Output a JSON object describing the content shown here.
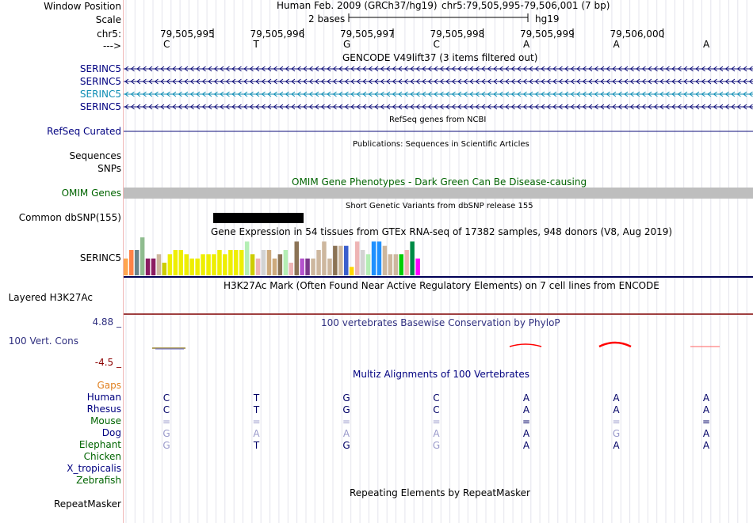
{
  "header": {
    "assembly": "Human Feb. 2009 (GRCh37/hg19)",
    "position": "chr5:79,505,995-79,506,001 (7 bp)",
    "scale_text": "2 bases",
    "scale_db": "hg19"
  },
  "ruler": {
    "chrom_label": "chr5:",
    "arrow_label": "--->",
    "ticks": [
      "79,505,995",
      "79,505,996",
      "79,505,997",
      "79,505,998",
      "79,505,999",
      "79,506,000"
    ],
    "bases": [
      "C",
      "T",
      "G",
      "C",
      "A",
      "A",
      "A"
    ]
  },
  "labels": {
    "window_position": "Window Position",
    "scale": "Scale",
    "gencode": [
      "SERINC5",
      "SERINC5",
      "SERINC5",
      "SERINC5"
    ],
    "refseq": "RefSeq Curated",
    "sequences": "Sequences",
    "snps": "SNPs",
    "omim": "OMIM Genes",
    "dbsnp": "Common dbSNP(155)",
    "gtex": "SERINC5",
    "h3k27ac": "Layered H3K27Ac",
    "cons": "100 Vert. Cons",
    "cons_max": "4.88 _",
    "cons_min": "-4.5 _",
    "repeatmasker": "RepeatMasker"
  },
  "tracks": {
    "gencode_title": "GENCODE V49lift37 (3 items filtered out)",
    "refseq_title": "RefSeq genes from NCBI",
    "pubs_title": "Publications: Sequences in Scientific Articles",
    "omim_title": "OMIM Gene Phenotypes - Dark Green Can Be Disease-causing",
    "dbsnp_title": "Short Genetic Variants from dbSNP release 155",
    "gtex_title": "Gene Expression in 54 tissues from GTEx RNA-seq of 17382 samples, 948 donors (V8, Aug 2019)",
    "h3k27ac_title": "H3K27Ac Mark (Often Found Near Active Regulatory Elements) on 7 cell lines from ENCODE",
    "phylop_title": "100 vertebrates Basewise Conservation by PhyloP",
    "multiz_title": "Multiz Alignments of 100 Vertebrates",
    "repeat_title": "Repeating Elements by RepeatMasker"
  },
  "gtex_colors": [
    "#ffa54f",
    "#ff8247",
    "#68838b",
    "#8fbc8f",
    "#8b1c62",
    "#8b1c62",
    "#cdb79e",
    "#cdcd00",
    "#eeee00",
    "#eeee00",
    "#eeee00",
    "#eeee00",
    "#eeee00",
    "#eeee00",
    "#eeee00",
    "#eeee00",
    "#eeee00",
    "#eeee00",
    "#eeee00",
    "#eeee00",
    "#eeee00",
    "#eeee00",
    "#b4eeb4",
    "#cdcd00",
    "#eeb4b4",
    "#d3d3d3",
    "#cdaa7d",
    "#cdaa7d",
    "#8b7355",
    "#b4eeb4",
    "#eeb4b4",
    "#8b7355",
    "#b452cd",
    "#7a378b",
    "#cdb79e",
    "#cdb79e",
    "#cdb79e",
    "#cdb79e",
    "#8b7355",
    "#cdb79e",
    "#3a5fcd",
    "#ffd700",
    "#eeb4b4",
    "#d3d3d3",
    "#b4eeb4",
    "#1e90ff",
    "#1e90ff",
    "#cdb79e",
    "#cdb79e",
    "#cdb79e",
    "#00cd00",
    "#eeb4b4",
    "#008b45",
    "#ff00ff"
  ],
  "gtex_values": [
    4,
    6,
    6,
    9,
    4,
    4,
    5,
    3,
    5,
    6,
    6,
    5,
    4,
    4,
    5,
    5,
    5,
    6,
    5,
    6,
    6,
    6,
    8,
    5,
    4,
    6,
    6,
    4,
    5,
    6,
    3,
    8,
    4,
    4,
    4,
    6,
    8,
    4,
    7,
    7,
    7,
    2,
    8,
    6,
    5,
    8,
    8,
    7,
    5,
    5,
    5,
    6,
    8,
    4
  ],
  "multiz": {
    "gaps_label": "Gaps",
    "species": [
      {
        "name": "Human",
        "color": "#000080",
        "bases": [
          "C",
          "T",
          "G",
          "C",
          "A",
          "A",
          "A"
        ],
        "base_colors": [
          "#000066",
          "#000066",
          "#000066",
          "#000066",
          "#000066",
          "#000066",
          "#000066"
        ]
      },
      {
        "name": "Rhesus",
        "color": "#000080",
        "bases": [
          "C",
          "T",
          "G",
          "C",
          "A",
          "A",
          "A"
        ],
        "base_colors": [
          "#000066",
          "#000066",
          "#000066",
          "#000066",
          "#000066",
          "#000066",
          "#000066"
        ]
      },
      {
        "name": "Mouse",
        "color": "#006400",
        "bases": [
          "=",
          "=",
          "=",
          "=",
          "=",
          "=",
          "="
        ],
        "base_colors": [
          "#9a9acb",
          "#9a9acb",
          "#9a9acb",
          "#9a9acb",
          "#000066",
          "#9a9acb",
          "#000066"
        ]
      },
      {
        "name": "Dog",
        "color": "#000080",
        "bases": [
          "G",
          "A",
          "A",
          "A",
          "A",
          "G",
          "A"
        ],
        "base_colors": [
          "#9a9acb",
          "#9a9acb",
          "#9a9acb",
          "#9a9acb",
          "#000066",
          "#9a9acb",
          "#000066"
        ]
      },
      {
        "name": "Elephant",
        "color": "#006400",
        "bases": [
          "G",
          "T",
          "G",
          "G",
          "A",
          "A",
          "A"
        ],
        "base_colors": [
          "#9a9acb",
          "#000066",
          "#000066",
          "#9a9acb",
          "#000066",
          "#000066",
          "#000066"
        ]
      },
      {
        "name": "Chicken",
        "color": "#006400",
        "bases": [],
        "base_colors": []
      },
      {
        "name": "X_tropicalis",
        "color": "#000080",
        "bases": [],
        "base_colors": []
      },
      {
        "name": "Zebrafish",
        "color": "#006400",
        "bases": [],
        "base_colors": []
      }
    ]
  },
  "colors": {
    "gene_navy": "#0c0c78",
    "serinc_selected": "#0c8cb4",
    "gencode_label": "#000080",
    "refseq": "#0c0c78",
    "omim_label": "#006400",
    "omim_bar": "#bebebe",
    "h3k27ac_line": "#000055",
    "phylop_line": "#800000",
    "cons_label": "#303080",
    "cons_max": "#303080",
    "cons_min": "#8b0000",
    "gaps": "#e08020",
    "phylop_red": "#ff0000"
  }
}
